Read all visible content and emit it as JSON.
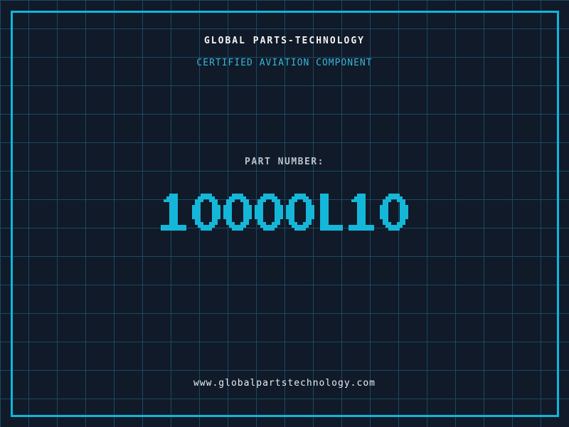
{
  "header": {
    "company_name": "GLOBAL PARTS-TECHNOLOGY",
    "tagline": "CERTIFIED AVIATION COMPONENT"
  },
  "part": {
    "label": "PART NUMBER:",
    "number": "10000L10"
  },
  "footer": {
    "website": "www.globalpartstechnology.com"
  },
  "colors": {
    "background": "#101a29",
    "grid_line": "#1a4a61",
    "frame": "#0db6dc",
    "accent_cyan": "#15b7d9",
    "tagline_cyan": "#3ab4d6",
    "title_text": "#f4f4f4",
    "label_text": "#b9c2ca",
    "url_text": "#e9edf0"
  }
}
